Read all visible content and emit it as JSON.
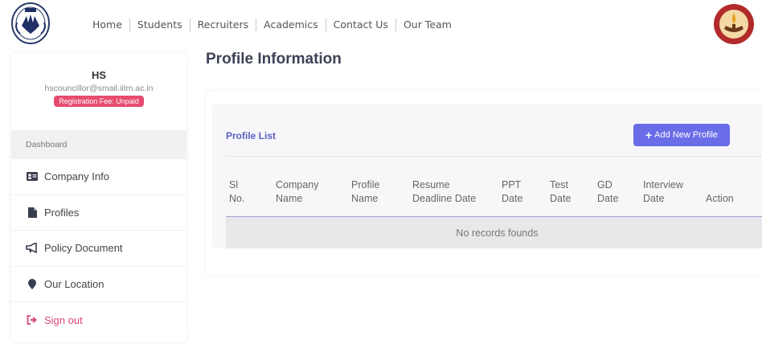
{
  "nav": {
    "items": [
      "Home",
      "Students",
      "Recruiters",
      "Academics",
      "Contact Us",
      "Our Team"
    ]
  },
  "sidebar": {
    "user_name": "HS",
    "user_email": "hscouncillor@smail.iitm.ac.in",
    "fee_status": "Registration Fee: Unpaid",
    "section_label": "Dashboard",
    "items": [
      {
        "label": "Company Info",
        "icon": "id-card-icon"
      },
      {
        "label": "Profiles",
        "icon": "file-icon"
      },
      {
        "label": "Policy Document",
        "icon": "megaphone-icon"
      },
      {
        "label": "Our Location",
        "icon": "map-pin-icon"
      },
      {
        "label": "Sign out",
        "icon": "sign-out-icon"
      }
    ]
  },
  "main": {
    "page_title": "Profile Information",
    "list_title": "Profile List",
    "add_button": "Add New Profile",
    "columns": [
      [
        "Sl",
        "No."
      ],
      [
        "Company",
        "Name"
      ],
      [
        "Profile",
        "Name"
      ],
      [
        "Resume",
        "Deadline Date"
      ],
      [
        "PPT",
        "Date"
      ],
      [
        "Test",
        "Date"
      ],
      [
        "GD",
        "Date"
      ],
      [
        "Interview",
        "Date"
      ],
      [
        "",
        "Action"
      ]
    ],
    "empty_message": "No records founds"
  },
  "colors": {
    "accent": "#6a6de8",
    "list_title": "#5a5fc4",
    "badge": "#e74c6f",
    "signout": "#d9467a"
  }
}
